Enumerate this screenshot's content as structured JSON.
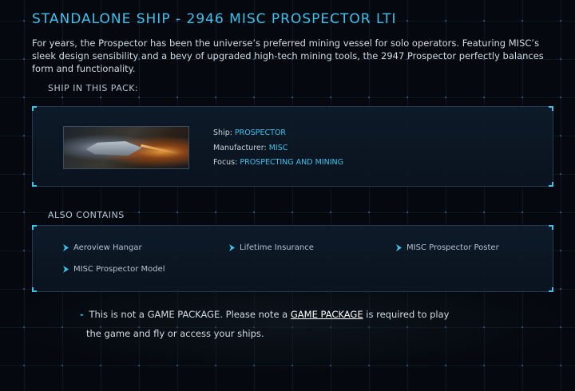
{
  "header": {
    "title": "STANDALONE SHIP - 2946 MISC PROSPECTOR LTI",
    "description": "For years, the Prospector has been the universe’s preferred mining vessel for solo operators. Featuring MISC’s sleek design sensibility and a bevy of upgraded high-tech mining tools, the 2947 Prospector perfectly balances form and functionality."
  },
  "ship_section": {
    "label": "SHIP IN THIS PACK:",
    "ship": {
      "ship_label": "Ship:",
      "ship_value": "PROSPECTOR",
      "manufacturer_label": "Manufacturer:",
      "manufacturer_value": "MISC",
      "focus_label": "Focus:",
      "focus_value": "PROSPECTING AND MINING"
    }
  },
  "also_contains": {
    "label": "ALSO CONTAINS",
    "items": [
      "Aeroview Hangar",
      "Lifetime Insurance",
      "MISC Prospector Poster",
      "MISC Prospector Model"
    ]
  },
  "note": {
    "dash": "-",
    "part1": "This is not a GAME PACKAGE. Please note a",
    "link": "GAME PACKAGE",
    "part2": "is required to play",
    "line2": "the game and fly or access your ships."
  },
  "colors": {
    "accent": "#3ec2ec",
    "background": "#05080e",
    "text": "#d3dbe2"
  }
}
